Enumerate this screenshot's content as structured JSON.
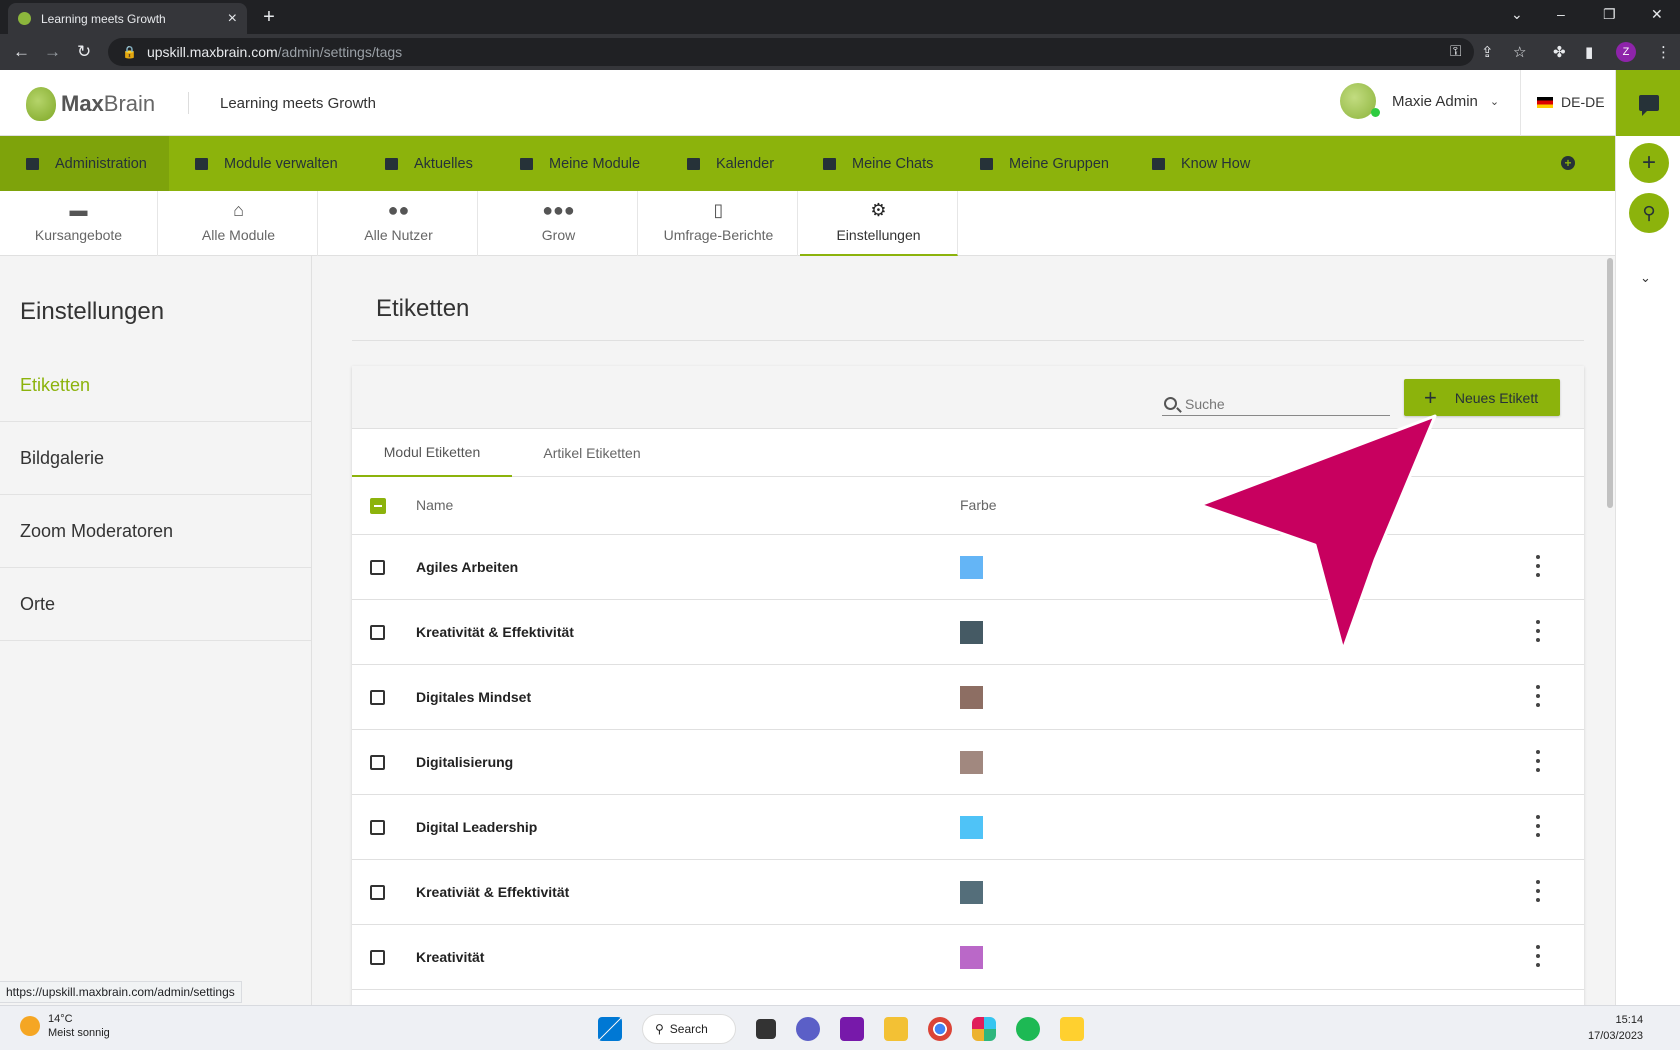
{
  "browser": {
    "tab_title": "Learning meets Growth",
    "url_host": "upskill.maxbrain.com",
    "url_path": "/admin/settings/tags",
    "profile_initial": "Z",
    "status_url": "https://upskill.maxbrain.com/admin/settings"
  },
  "header": {
    "logo_prefix": "Max",
    "logo_suffix": "Brain",
    "tagline": "Learning meets Growth",
    "user_name": "Maxie Admin",
    "language": "DE-DE"
  },
  "main_nav": {
    "items": [
      {
        "label": "Administration",
        "active": true
      },
      {
        "label": "Module verwalten"
      },
      {
        "label": "Aktuelles"
      },
      {
        "label": "Meine Module"
      },
      {
        "label": "Kalender"
      },
      {
        "label": "Meine Chats"
      },
      {
        "label": "Meine Gruppen"
      },
      {
        "label": "Know How"
      }
    ]
  },
  "sub_tabs": [
    {
      "label": "Kursangebote",
      "icon": "hand-book-icon"
    },
    {
      "label": "Alle Module",
      "icon": "institution-icon"
    },
    {
      "label": "Alle Nutzer",
      "icon": "people-icon"
    },
    {
      "label": "Grow",
      "icon": "group-icon"
    },
    {
      "label": "Umfrage-Berichte",
      "icon": "report-icon"
    },
    {
      "label": "Einstellungen",
      "icon": "gears-icon",
      "active": true
    }
  ],
  "sidebar": {
    "title": "Einstellungen",
    "items": [
      {
        "label": "Etiketten",
        "active": true
      },
      {
        "label": "Bildgalerie"
      },
      {
        "label": "Zoom Moderatoren"
      },
      {
        "label": "Orte"
      }
    ]
  },
  "main": {
    "title": "Etiketten",
    "search_placeholder": "Suche",
    "new_button": "Neues Etikett",
    "tabs": [
      {
        "label": "Modul Etiketten",
        "active": true
      },
      {
        "label": "Artikel Etiketten"
      }
    ],
    "columns": {
      "name": "Name",
      "color": "Farbe"
    },
    "rows": [
      {
        "name": "Agiles Arbeiten",
        "color": "#64b5f6"
      },
      {
        "name": "Kreativität & Effektivität",
        "color": "#455a64"
      },
      {
        "name": "Digitales Mindset",
        "color": "#8d6e63"
      },
      {
        "name": "Digitalisierung",
        "color": "#a1887f"
      },
      {
        "name": "Digital Leadership",
        "color": "#4fc3f7"
      },
      {
        "name": "Kreativiät & Effektivität",
        "color": "#546e7a"
      },
      {
        "name": "Kreativität",
        "color": "#ba68c8"
      }
    ]
  },
  "taskbar": {
    "temperature": "14°C",
    "weather": "Meist sonnig",
    "search_label": "Search",
    "time": "15:14",
    "date": "17/03/2023"
  },
  "colors": {
    "brand_green": "#8cb30c",
    "annotation_arrow": "#c8005f"
  }
}
